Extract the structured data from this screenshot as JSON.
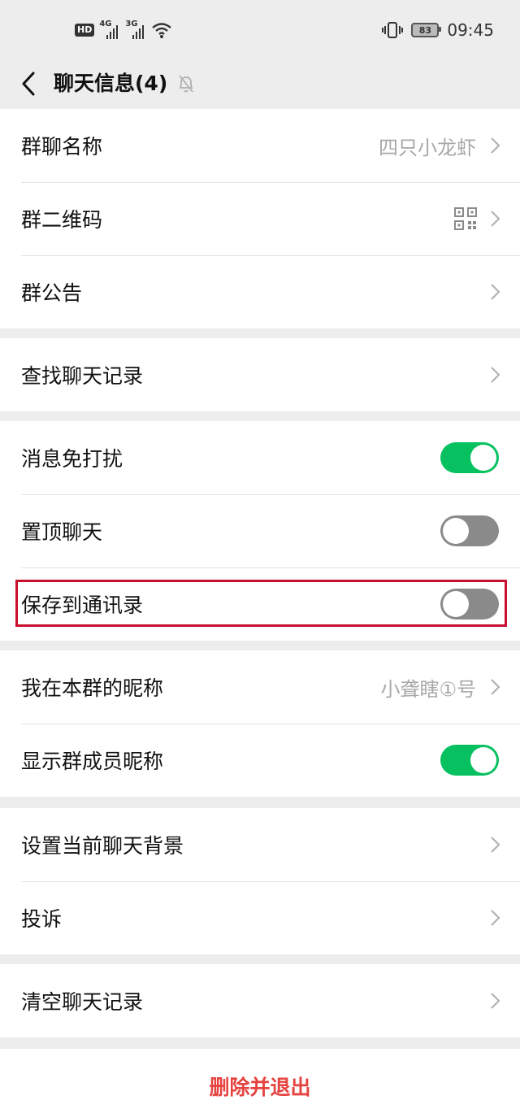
{
  "status_bar": {
    "hd": "HD",
    "net1": "4G",
    "net2": "3G",
    "battery": "83",
    "time": "09:45",
    "icons": [
      "hd-icon",
      "signal-icon",
      "wifi-icon",
      "vibrate-icon",
      "battery-icon"
    ]
  },
  "nav": {
    "title": "聊天信息(4)",
    "icons": [
      "back-arrow-icon",
      "mute-bell-icon"
    ]
  },
  "groups": [
    [
      {
        "label": "群聊名称",
        "value": "四只小龙虾",
        "kind": "link"
      },
      {
        "label": "群二维码",
        "kind": "qr"
      },
      {
        "label": "群公告",
        "kind": "link"
      }
    ],
    [
      {
        "label": "查找聊天记录",
        "kind": "link"
      }
    ],
    [
      {
        "label": "消息免打扰",
        "kind": "toggle",
        "on": true
      },
      {
        "label": "置顶聊天",
        "kind": "toggle",
        "on": false
      },
      {
        "label": "保存到通讯录",
        "kind": "toggle",
        "on": false
      }
    ],
    [
      {
        "label": "我在本群的昵称",
        "value": "小聋瞎①号",
        "kind": "link"
      },
      {
        "label": "显示群成员昵称",
        "kind": "toggle",
        "on": true
      }
    ],
    [
      {
        "label": "设置当前聊天背景",
        "kind": "link"
      },
      {
        "label": "投诉",
        "kind": "link"
      }
    ],
    [
      {
        "label": "清空聊天记录",
        "kind": "link"
      }
    ]
  ],
  "delete_button": "删除并退出",
  "colors": {
    "background": "#ededed",
    "toggle_on": "#07c160",
    "toggle_off": "#8a8a8a",
    "danger": "#e64340",
    "highlight_box": "#c8102e"
  }
}
